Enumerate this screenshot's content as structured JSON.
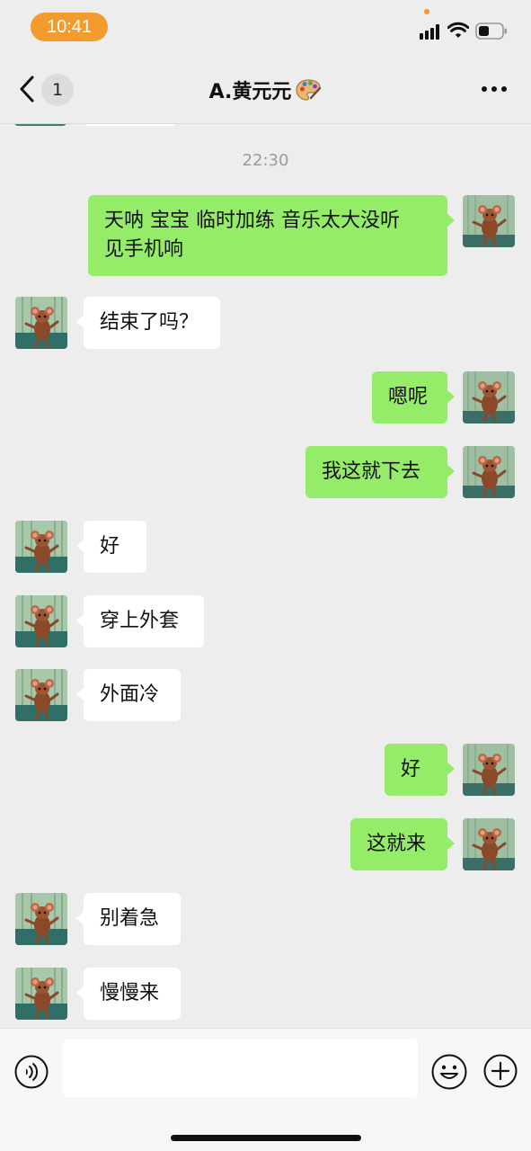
{
  "status_bar": {
    "time": "10:41"
  },
  "nav": {
    "back_badge": "1",
    "title": "A.黄元元",
    "title_icon": "palette-icon"
  },
  "chat": {
    "timestamp": "22:30",
    "messages": [
      {
        "side": "out",
        "text": "天呐 宝宝 临时加练 音乐太大没听\n见手机响"
      },
      {
        "side": "in",
        "text": "结束了吗？"
      },
      {
        "side": "out",
        "text": "嗯呢"
      },
      {
        "side": "out",
        "text": "我这就下去"
      },
      {
        "side": "in",
        "text": "好"
      },
      {
        "side": "in",
        "text": "穿上外套"
      },
      {
        "side": "in",
        "text": "外面冷"
      },
      {
        "side": "out",
        "text": "好"
      },
      {
        "side": "out",
        "text": "这就来"
      },
      {
        "side": "in",
        "text": "别着急"
      },
      {
        "side": "in",
        "text": "慢慢来"
      }
    ]
  },
  "input_bar": {
    "placeholder": "",
    "value": ""
  },
  "colors": {
    "outgoing_bubble": "#95ec69",
    "incoming_bubble": "#ffffff",
    "background": "#ededed",
    "time_pill": "#f39c2d"
  }
}
